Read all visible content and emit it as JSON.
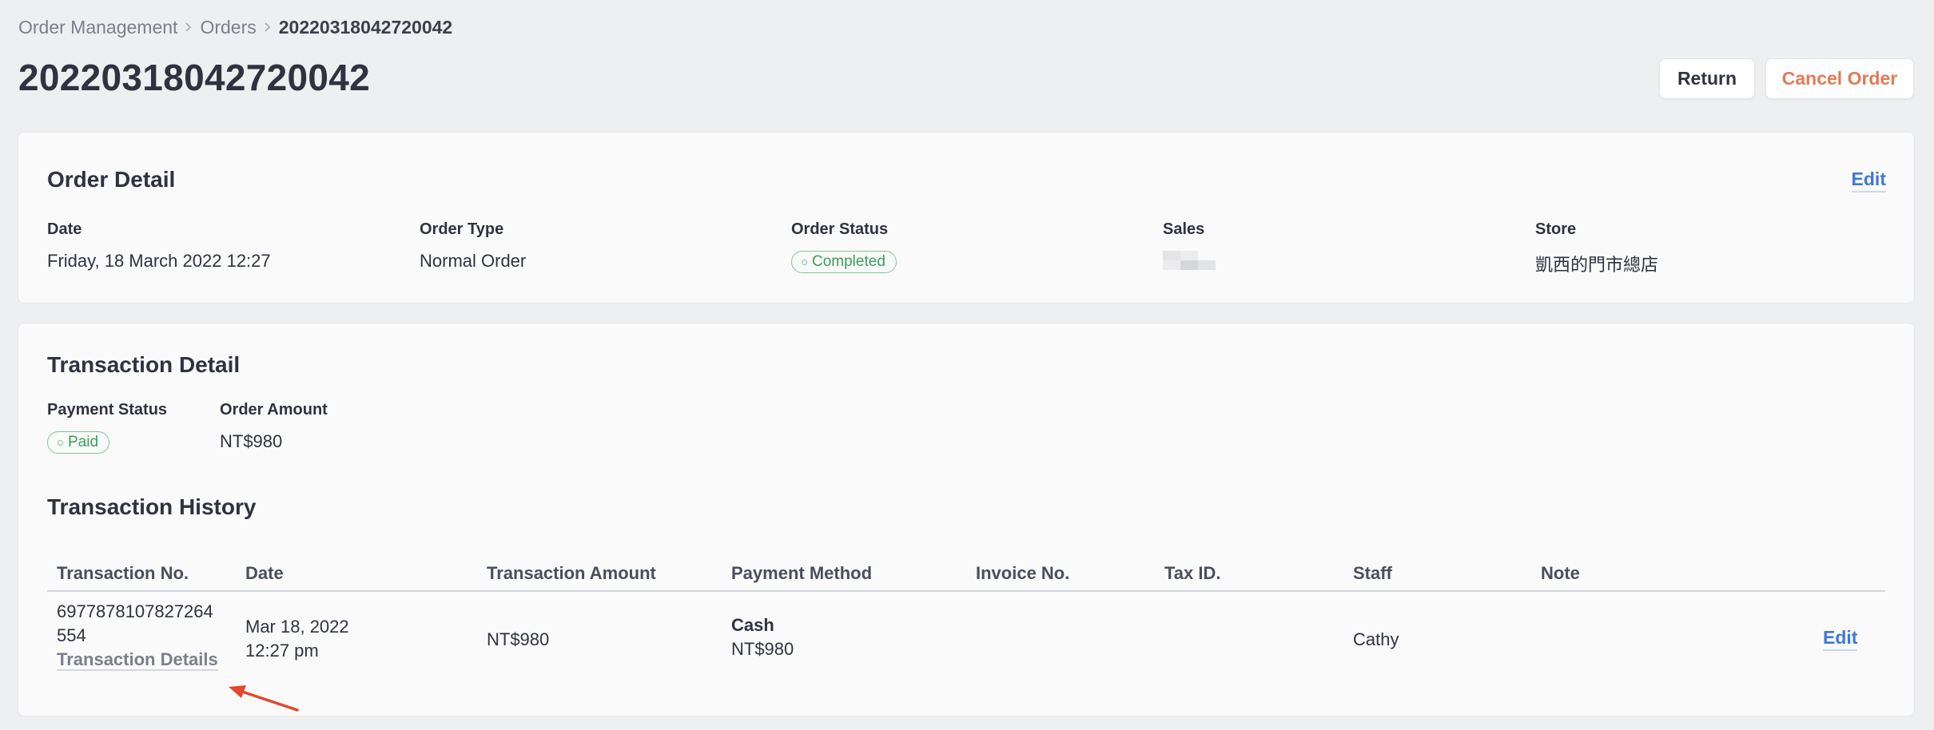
{
  "breadcrumb": {
    "items": [
      "Order Management",
      "Orders",
      "20220318042720042"
    ]
  },
  "header": {
    "title": "20220318042720042",
    "return_label": "Return",
    "cancel_label": "Cancel Order"
  },
  "order_detail": {
    "title": "Order Detail",
    "edit_label": "Edit",
    "date_label": "Date",
    "date_value": "Friday, 18 March 2022 12:27",
    "type_label": "Order Type",
    "type_value": "Normal Order",
    "status_label": "Order Status",
    "status_value": "Completed",
    "sales_label": "Sales",
    "store_label": "Store",
    "store_value": "凱西的門市總店"
  },
  "transaction_detail": {
    "title": "Transaction Detail",
    "payment_status_label": "Payment Status",
    "payment_status_value": "Paid",
    "order_amount_label": "Order Amount",
    "order_amount_value": "NT$980"
  },
  "transaction_history": {
    "title": "Transaction History",
    "columns": [
      "Transaction No.",
      "Date",
      "Transaction Amount",
      "Payment Method",
      "Invoice No.",
      "Tax ID.",
      "Staff",
      "Note"
    ],
    "rows": [
      {
        "transaction_no_line1": "6977878107827264",
        "transaction_no_line2": "554",
        "details_link": "Transaction Details",
        "date_line1": "Mar 18, 2022",
        "date_line2": "12:27 pm",
        "amount": "NT$980",
        "payment_method": "Cash",
        "payment_amount": "NT$980",
        "invoice_no": "",
        "tax_id": "",
        "staff": "Cathy",
        "note": "",
        "edit_label": "Edit"
      }
    ]
  },
  "colors": {
    "background": "#eeeff1",
    "link": "#3f78d6",
    "cancel": "#e27a56",
    "status_green": "#3f9a5e",
    "annotation_arrow": "#e0492c"
  }
}
